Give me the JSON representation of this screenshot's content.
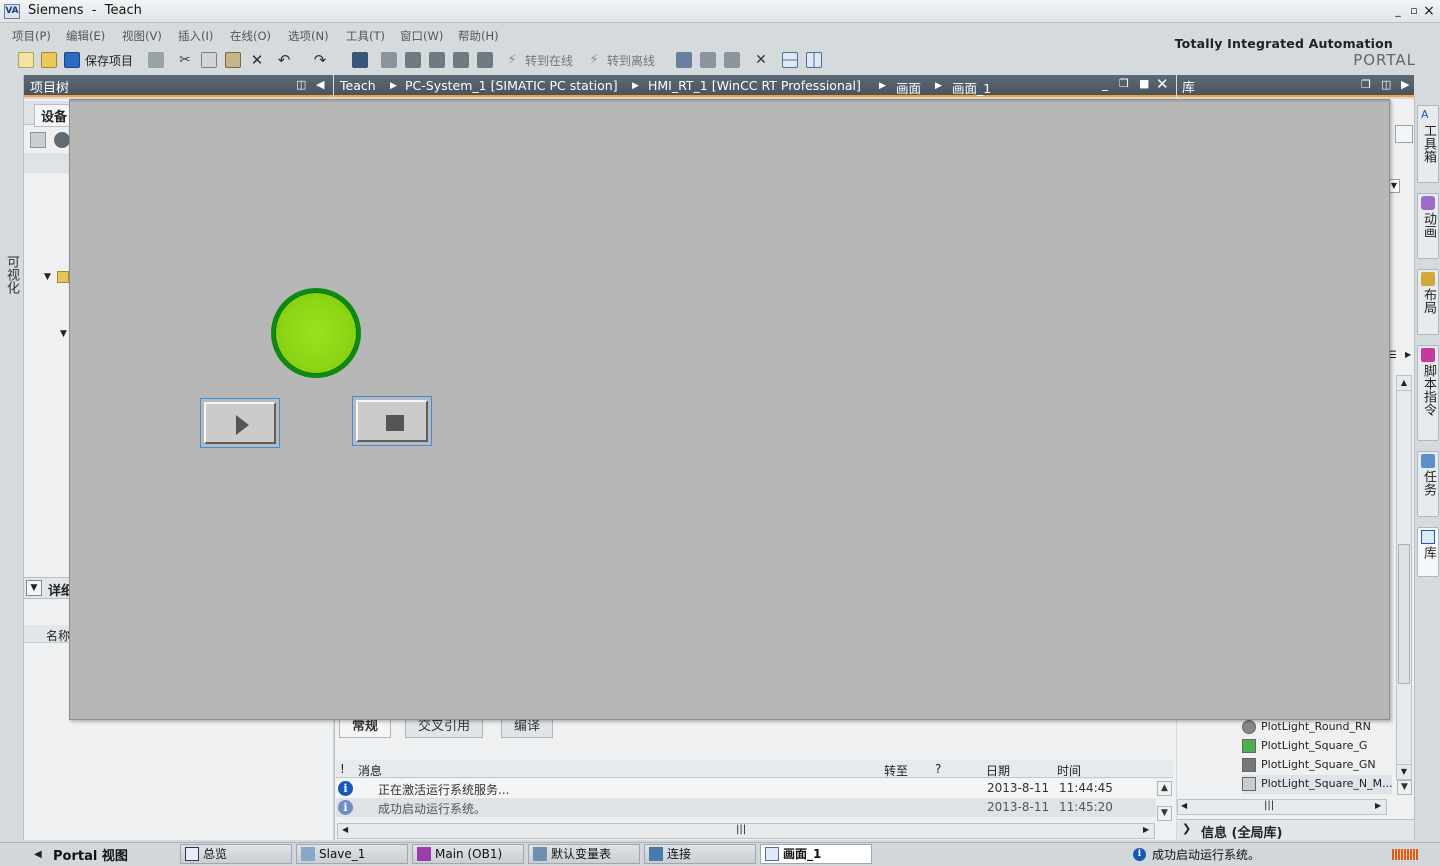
{
  "app": {
    "logo_text": "VA",
    "window_title": "Siemens  -  Teach"
  },
  "window_controls": {
    "minimize": "_",
    "restore": "▫",
    "close": "×"
  },
  "menu": [
    "项目(P)",
    "编辑(E)",
    "视图(V)",
    "插入(I)",
    "在线(O)",
    "选项(N)",
    "工具(T)",
    "窗口(W)",
    "帮助(H)"
  ],
  "toolbar": {
    "save_project": "保存项目",
    "go_online": "转到在线",
    "go_offline": "转到离线"
  },
  "brand": {
    "line1": "Totally Integrated Automation",
    "line2": "PORTAL"
  },
  "left_strip": {
    "vertical_label": "可视化"
  },
  "project_tree": {
    "title": "项目树",
    "tab_devices": "设备",
    "details_label": "详细",
    "name_column": "名称"
  },
  "editor": {
    "breadcrumb": [
      "Teach",
      "PC-System_1 [SIMATIC PC station]",
      "HMI_RT_1 [WinCC RT Professional]",
      "画面",
      "画面_1"
    ]
  },
  "library": {
    "title": "库",
    "items": [
      {
        "label": "PlotLight_Round_RN",
        "color": "#888888"
      },
      {
        "label": "PlotLight_Square_G",
        "color": "#4caf50"
      },
      {
        "label": "PlotLight_Square_GN",
        "color": "#777777"
      },
      {
        "label": "PlotLight_Square_N_M...",
        "color": "#cccccc"
      }
    ],
    "info_label": "信息 (全局库)"
  },
  "right_tabs": [
    "工具箱",
    "动画",
    "布局",
    "脚本指令",
    "任务",
    "库"
  ],
  "inspector": {
    "tabs": [
      "常规",
      "交叉引用",
      "编译"
    ],
    "columns": {
      "flag": "!",
      "message": "消息",
      "goto": "转至",
      "question": "?",
      "date": "日期",
      "time": "时间"
    },
    "messages": [
      {
        "text": "正在激活运行系统服务...",
        "date": "2013-8-11",
        "time": "11:44:45"
      },
      {
        "text": "成功启动运行系统。",
        "date": "2013-8-11",
        "time": "11:45:20"
      }
    ]
  },
  "hmi_runtime": {
    "lamp_state": "on",
    "lamp_color": "#8ad514",
    "start_icon": "play-icon",
    "stop_icon": "stop-icon"
  },
  "taskbar": {
    "portal_view": "Portal 视图",
    "tasks": [
      "总览",
      "Slave_1",
      "Main (OB1)",
      "默认变量表",
      "连接",
      "画面_1"
    ],
    "status": "成功启动运行系统。"
  }
}
